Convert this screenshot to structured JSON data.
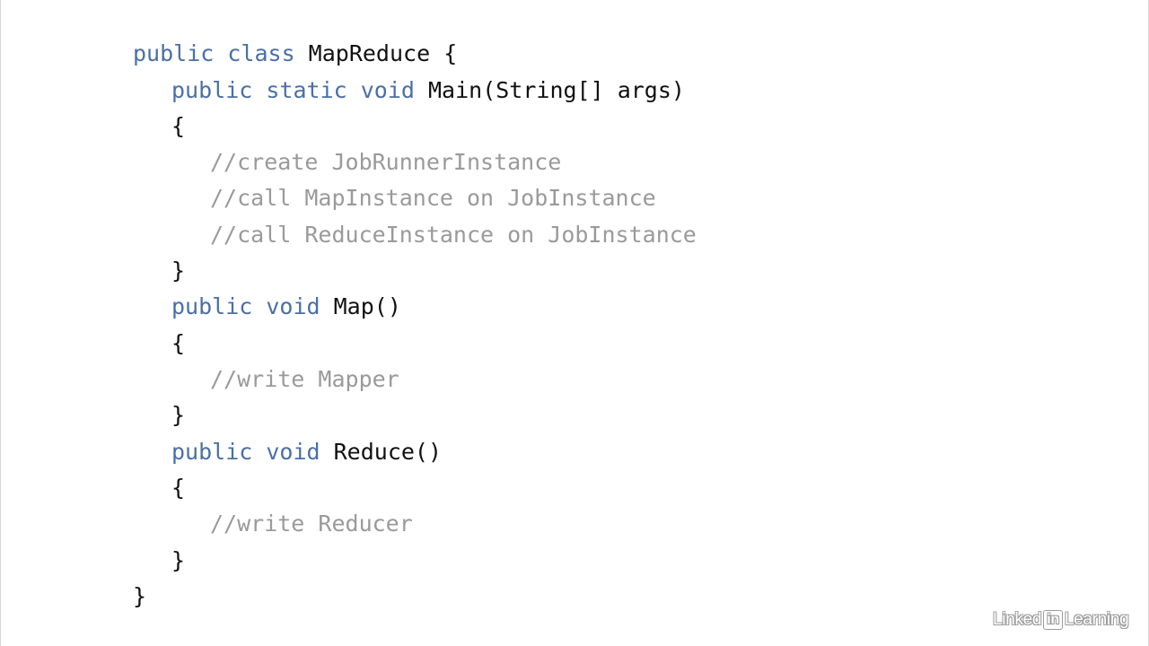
{
  "code": {
    "class_decl": {
      "kw": "public class ",
      "name": "MapReduce",
      "brace": " {"
    },
    "main_decl": {
      "kw": "public static void ",
      "sig": "Main(String[] args)"
    },
    "main_open": "{",
    "main_comments": [
      "//create JobRunnerInstance",
      "//call MapInstance on JobInstance",
      "//call ReduceInstance on JobInstance"
    ],
    "main_close": "}",
    "map_decl": {
      "kw": "public void ",
      "sig": "Map()"
    },
    "map_open": "{",
    "map_comment": "//write Mapper",
    "map_close": "}",
    "reduce_decl": {
      "kw": "public void ",
      "sig": "Reduce()"
    },
    "reduce_open": "{",
    "reduce_comment": "//write Reducer",
    "reduce_close": "}",
    "class_close": "}"
  },
  "watermark": {
    "part1": "Linked",
    "part2": "in",
    "part3": "Learning"
  },
  "colors": {
    "keyword": "#4a6fa8",
    "comment": "#9a9a9a",
    "text": "#111111",
    "background": "#ffffff"
  }
}
